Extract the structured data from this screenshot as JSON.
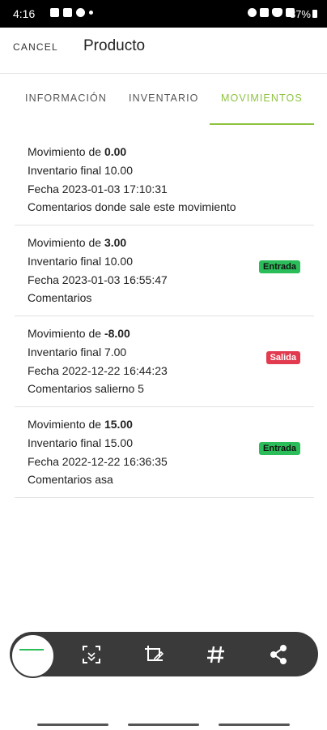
{
  "status_bar": {
    "time": "4:16",
    "battery": "87%"
  },
  "app_bar": {
    "cancel_label": "CANCEL",
    "title": "Producto"
  },
  "tabs": [
    {
      "label": "INFORMACIÓN"
    },
    {
      "label": "INVENTARIO"
    },
    {
      "label": "MOVIMIENTOS",
      "active": true
    }
  ],
  "movements": [
    {
      "prefix": "Movimiento de ",
      "amount": "0.00",
      "final": "Inventario final 10.00",
      "date": "Fecha 2023-01-03 17:10:31",
      "comments": "Comentarios donde sale este movimiento",
      "badge": ""
    },
    {
      "prefix": "Movimiento de ",
      "amount": "3.00",
      "final": "Inventario final 10.00",
      "date": "Fecha 2023-01-03 16:55:47",
      "comments": "Comentarios",
      "badge": "Entrada"
    },
    {
      "prefix": "Movimiento de ",
      "amount": "-8.00",
      "final": "Inventario final 7.00",
      "date": "Fecha 2022-12-22 16:44:23",
      "comments": "Comentarios salierno 5",
      "badge": "Salida"
    },
    {
      "prefix": "Movimiento de ",
      "amount": "15.00",
      "final": "Inventario final 15.00",
      "date": "Fecha 2022-12-22 16:36:35",
      "comments": "Comentarios asa",
      "badge": "Entrada"
    }
  ],
  "toolbar": {
    "icons": [
      "scan-icon",
      "crop-edit-icon",
      "hash-icon",
      "share-icon"
    ]
  },
  "colors": {
    "accent": "#8dc33f",
    "entrada": "#2bbd5a",
    "salida": "#e23a4e"
  }
}
